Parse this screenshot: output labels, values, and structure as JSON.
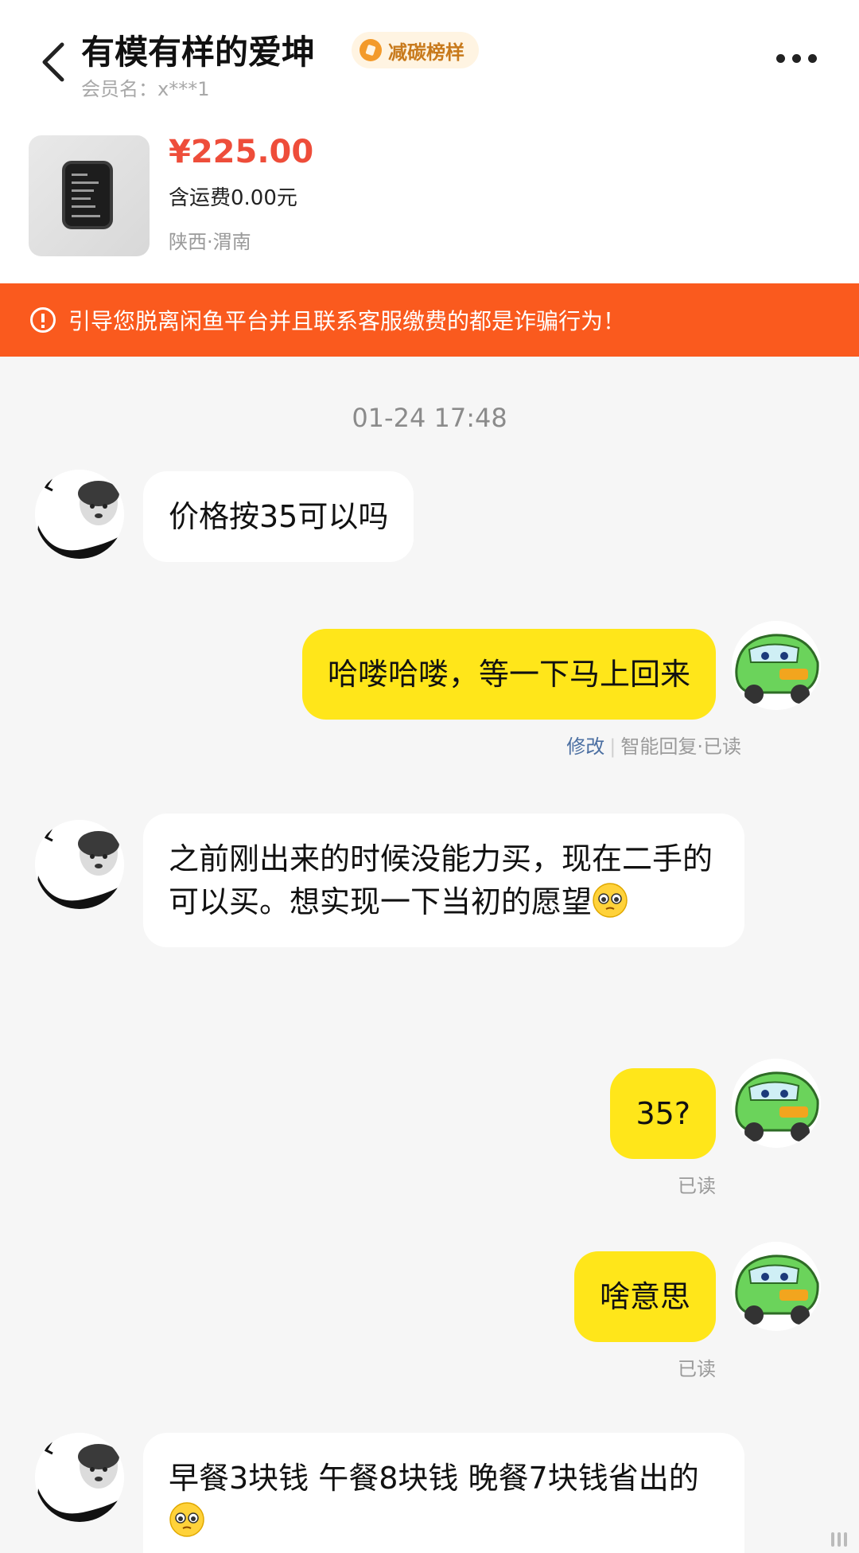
{
  "header": {
    "title": "有模有样的爱坤",
    "badge": "减碳榜样",
    "member": "会员名：x***1"
  },
  "product": {
    "price": "¥225.00",
    "shipping": "含运费0.00元",
    "location": "陕西·渭南"
  },
  "warning": "引导您脱离闲鱼平台并且联系客服缴费的都是诈骗行为！",
  "chat": {
    "timestamp": "01-24 17:48",
    "messages": [
      {
        "side": "left",
        "text": "价格按35可以吗"
      },
      {
        "side": "right",
        "text": "哈喽哈喽，等一下马上回来",
        "edit": "修改",
        "status": "智能回复·已读"
      },
      {
        "side": "left",
        "text": "之前刚出来的时候没能力买，现在二手的可以买。想实现一下当初的愿望"
      },
      {
        "side": "right",
        "text": "35?",
        "status": "已读"
      },
      {
        "side": "right",
        "text": "啥意思",
        "status": "已读"
      },
      {
        "side": "left",
        "text": "早餐3块钱 午餐8块钱 晚餐7块钱省出的"
      }
    ]
  },
  "colors": {
    "price": "#ee4d3a",
    "warning_bg": "#fa5a1e",
    "bubble_mine": "#ffe61a",
    "edit_link": "#4b6fa2"
  },
  "icons": {
    "back": "chevron-left-icon",
    "more": "more-dots-icon",
    "badge": "leaf-badge-icon",
    "warning": "alert-circle-icon",
    "emoji": "pleading-face-emoji"
  }
}
